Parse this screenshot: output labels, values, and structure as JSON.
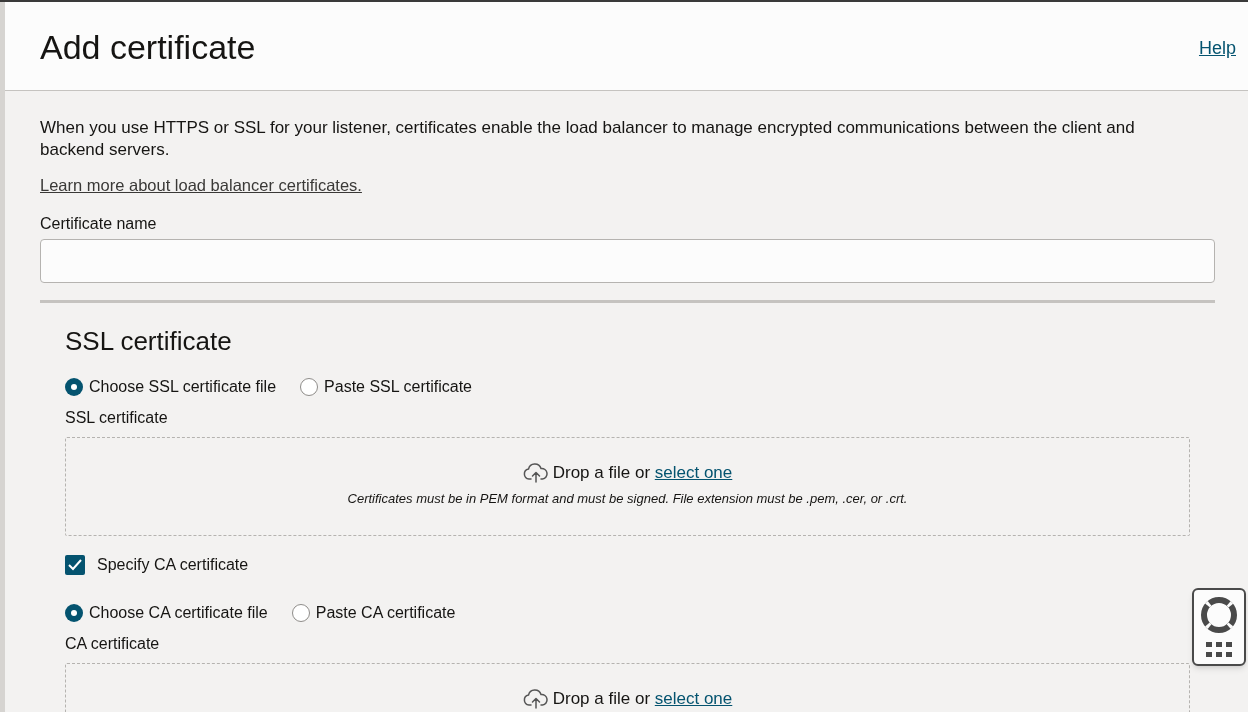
{
  "header": {
    "title": "Add certificate",
    "help_link": "Help"
  },
  "intro": "When you use HTTPS or SSL for your listener, certificates enable the load balancer to manage encrypted communications between the client and backend servers.",
  "learn_more_link": "Learn more about load balancer certificates.",
  "certificate_name": {
    "label": "Certificate name"
  },
  "ssl_section": {
    "title": "SSL certificate",
    "ssl_source": [
      {
        "label": "Choose SSL certificate file",
        "selected": true
      },
      {
        "label": "Paste SSL certificate",
        "selected": false
      }
    ],
    "ssl_upload": {
      "label": "SSL certificate",
      "prompt": "Drop a file or",
      "link": "select one",
      "hint": "Certificates must be in PEM format and must be signed. File extension must be .pem, .cer, or .crt."
    },
    "specify_ca": {
      "label": "Specify CA certificate",
      "checked": true
    },
    "ca_source": [
      {
        "label": "Choose CA certificate file",
        "selected": true
      },
      {
        "label": "Paste CA certificate",
        "selected": false
      }
    ],
    "ca_upload": {
      "label": "CA certificate",
      "prompt": "Drop a file or",
      "link": "select one"
    }
  }
}
